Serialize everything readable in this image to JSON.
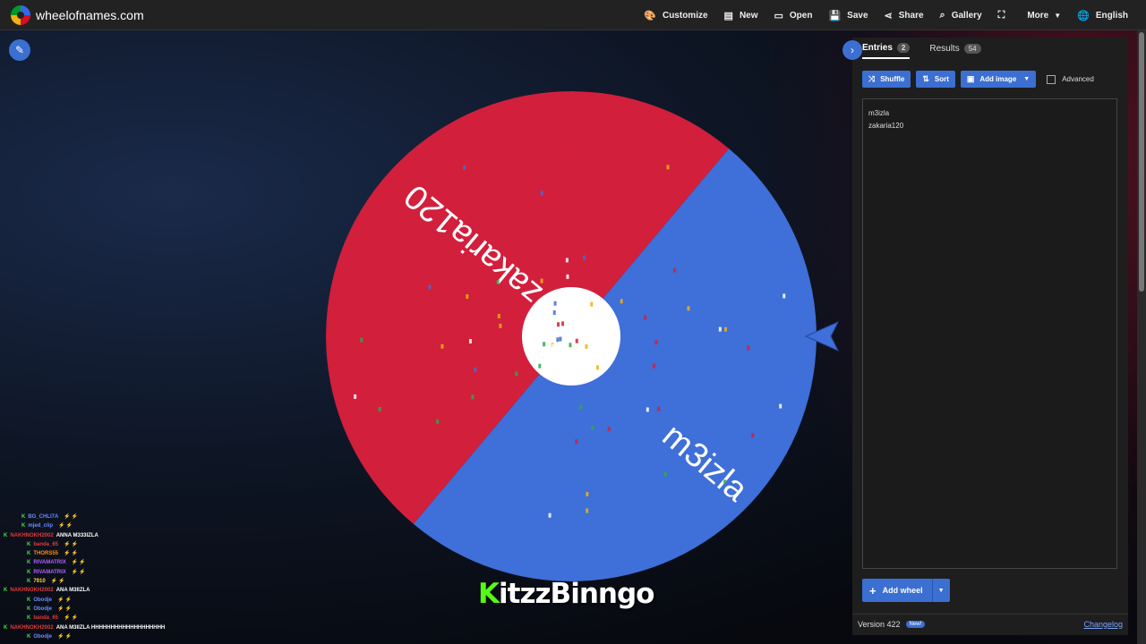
{
  "header": {
    "site_name": "wheelofnames.com",
    "nav": [
      {
        "label": "Customize",
        "icon": "palette-icon",
        "glyph": "🎨"
      },
      {
        "label": "New",
        "icon": "file-icon",
        "glyph": "▤"
      },
      {
        "label": "Open",
        "icon": "folder-icon",
        "glyph": "▭"
      },
      {
        "label": "Save",
        "icon": "save-icon",
        "glyph": "💾"
      },
      {
        "label": "Share",
        "icon": "share-icon",
        "glyph": "⋖"
      },
      {
        "label": "Gallery",
        "icon": "search-icon",
        "glyph": "⌕"
      },
      {
        "label": "",
        "icon": "fullscreen-icon",
        "glyph": "⛶"
      },
      {
        "label": "More",
        "icon": "",
        "glyph": ""
      },
      {
        "label": "English",
        "icon": "globe-icon",
        "glyph": "🌐"
      }
    ]
  },
  "wheel": {
    "segments": [
      {
        "label": "zakaria120",
        "color": "#d21f3c"
      },
      {
        "label": "m3izla",
        "color": "#3f6fd8"
      }
    ],
    "center_color": "#ffffff"
  },
  "panel": {
    "tabs": [
      {
        "label": "Entries",
        "count": "2",
        "active": true
      },
      {
        "label": "Results",
        "count": "54",
        "active": false
      }
    ],
    "buttons": {
      "shuffle": "Shuffle",
      "sort": "Sort",
      "add_image": "Add image",
      "advanced": "Advanced"
    },
    "entries": [
      "m3izla",
      "zakaria120"
    ],
    "add_wheel": "Add wheel",
    "version": "Version 422",
    "new_badge": "New!",
    "changelog": "Changelog"
  },
  "chat": [
    {
      "user": "BG_CHLI7A",
      "color": "#6a8cff",
      "msg": ""
    },
    {
      "user": "mjed_clip",
      "color": "#6a8cff",
      "msg": ""
    },
    {
      "user": "NAKHNOKH2002",
      "color": "#e23a3a",
      "msg": "ANNA M333IZLA"
    },
    {
      "user": "banda_65",
      "color": "#e23a3a",
      "msg": ""
    },
    {
      "user": "THORS55",
      "color": "#ff8c1a",
      "msg": ""
    },
    {
      "user": "RIVAMATRIX",
      "color": "#b060ff",
      "msg": ""
    },
    {
      "user": "RIVAMATRIX",
      "color": "#b060ff",
      "msg": ""
    },
    {
      "user": "7910",
      "color": "#ffd23a",
      "msg": ""
    },
    {
      "user": "NAKHNOKH2002",
      "color": "#e23a3a",
      "msg": "ANA M3IIZLA"
    },
    {
      "user": "Obodje",
      "color": "#6a8cff",
      "msg": ""
    },
    {
      "user": "Obodje",
      "color": "#6a8cff",
      "msg": ""
    },
    {
      "user": "banda_65",
      "color": "#e23a3a",
      "msg": ""
    },
    {
      "user": "NAKHNOKH2002",
      "color": "#e23a3a",
      "msg": "ANA M3IIZLA HHHHHHHHHHHHHHHHHHH"
    },
    {
      "user": "Obodje",
      "color": "#6a8cff",
      "msg": ""
    }
  ],
  "watermark": {
    "k": "K",
    "rest": "itzzBinngo"
  }
}
